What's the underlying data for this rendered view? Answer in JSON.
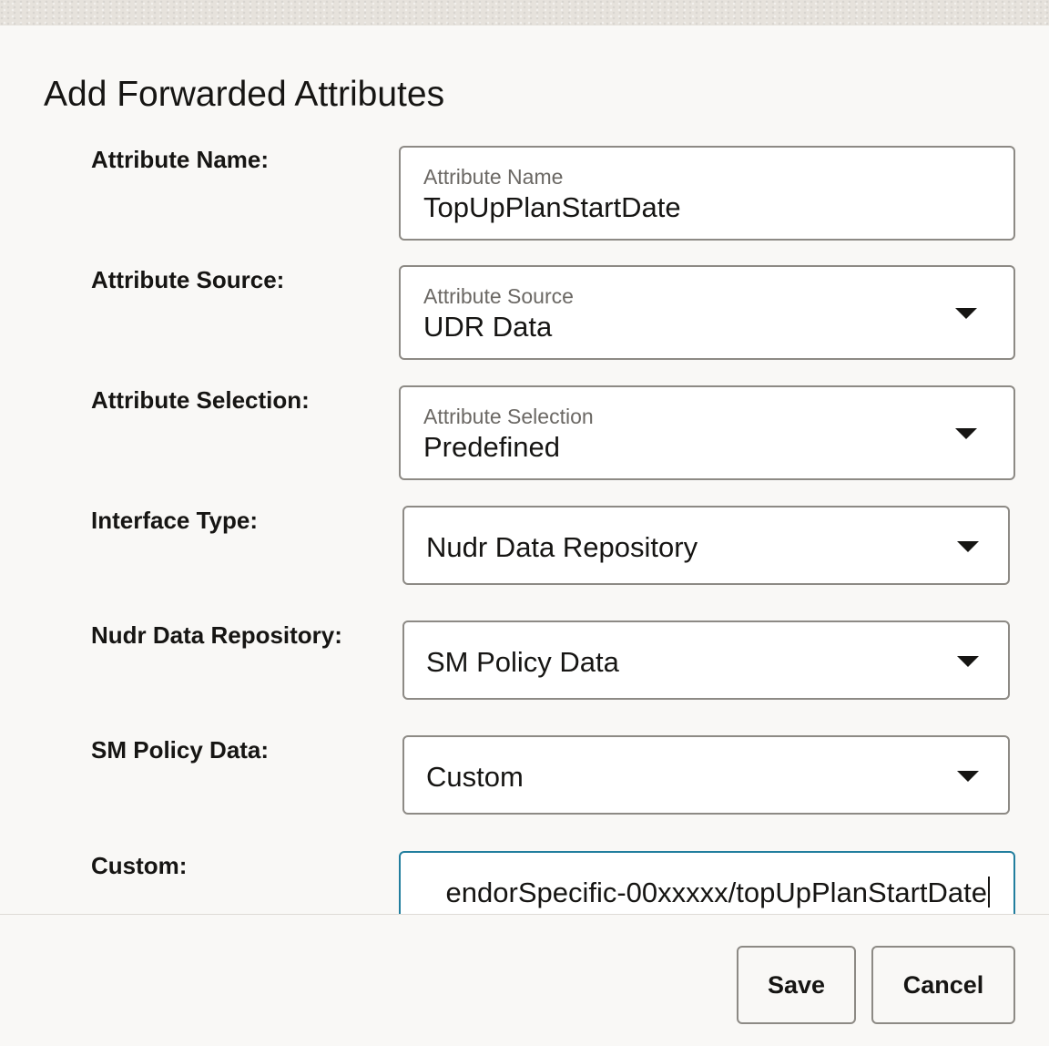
{
  "dialog": {
    "title": "Add Forwarded Attributes"
  },
  "form": {
    "attribute_name": {
      "row_label": "Attribute Name:",
      "field_label": "Attribute Name",
      "value": "TopUpPlanStartDate"
    },
    "attribute_source": {
      "row_label": "Attribute Source:",
      "field_label": "Attribute Source",
      "value": "UDR Data"
    },
    "attribute_selection": {
      "row_label": "Attribute Selection:",
      "field_label": "Attribute Selection",
      "value": "Predefined"
    },
    "interface_type": {
      "row_label": "Interface Type:",
      "value": "Nudr Data Repository"
    },
    "nudr_data_repository": {
      "row_label": "Nudr Data Repository:",
      "value": "SM Policy Data"
    },
    "sm_policy_data": {
      "row_label": "SM Policy Data:",
      "value": "Custom"
    },
    "custom": {
      "row_label": "Custom:",
      "value": "endorSpecific-00xxxxx/topUpPlanStartDate"
    }
  },
  "footer": {
    "save_label": "Save",
    "cancel_label": "Cancel"
  },
  "icons": {
    "dropdown": "chevron-down-icon"
  },
  "colors": {
    "focus_border": "#227e9e",
    "field_border": "#8d8a85",
    "background": "#f9f8f6"
  }
}
